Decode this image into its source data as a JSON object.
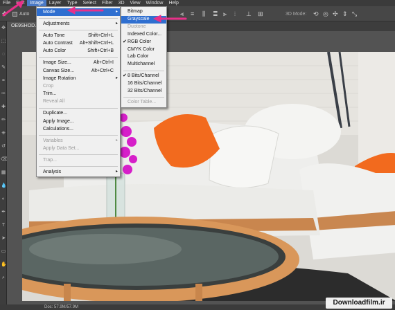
{
  "menubar": {
    "items": [
      "File",
      "Edit",
      "Image",
      "Layer",
      "Type",
      "Select",
      "Filter",
      "3D",
      "View",
      "Window",
      "Help"
    ],
    "active_index": 2
  },
  "options_bar": {
    "auto_label": "Auto",
    "mode_label": "3D Mode:"
  },
  "document": {
    "tab_title": "OE9SHOD.jp"
  },
  "image_menu": {
    "items": [
      {
        "label": "Mode",
        "submenu": true,
        "highlighted": true
      },
      {
        "separator": true
      },
      {
        "label": "Adjustments",
        "submenu": true
      },
      {
        "separator": true
      },
      {
        "label": "Auto Tone",
        "shortcut": "Shift+Ctrl+L"
      },
      {
        "label": "Auto Contrast",
        "shortcut": "Alt+Shift+Ctrl+L"
      },
      {
        "label": "Auto Color",
        "shortcut": "Shift+Ctrl+B"
      },
      {
        "separator": true
      },
      {
        "label": "Image Size...",
        "shortcut": "Alt+Ctrl+I"
      },
      {
        "label": "Canvas Size...",
        "shortcut": "Alt+Ctrl+C"
      },
      {
        "label": "Image Rotation",
        "submenu": true
      },
      {
        "label": "Crop",
        "disabled": true
      },
      {
        "label": "Trim..."
      },
      {
        "label": "Reveal All",
        "disabled": true
      },
      {
        "separator": true
      },
      {
        "label": "Duplicate..."
      },
      {
        "label": "Apply Image..."
      },
      {
        "label": "Calculations..."
      },
      {
        "separator": true
      },
      {
        "label": "Variables",
        "submenu": true,
        "disabled": true
      },
      {
        "label": "Apply Data Set...",
        "disabled": true
      },
      {
        "separator": true
      },
      {
        "label": "Trap...",
        "disabled": true
      },
      {
        "separator": true
      },
      {
        "label": "Analysis",
        "submenu": true
      }
    ]
  },
  "mode_submenu": {
    "items": [
      {
        "label": "Bitmap"
      },
      {
        "label": "Grayscale",
        "highlighted": true
      },
      {
        "label": "Duotone",
        "disabled": true
      },
      {
        "label": "Indexed Color..."
      },
      {
        "label": "RGB Color",
        "checked": true
      },
      {
        "label": "CMYK Color"
      },
      {
        "label": "Lab Color"
      },
      {
        "label": "Multichannel"
      },
      {
        "separator": true
      },
      {
        "label": "8 Bits/Channel",
        "checked": true
      },
      {
        "label": "16 Bits/Channel"
      },
      {
        "label": "32 Bits/Channel"
      },
      {
        "separator": true
      },
      {
        "label": "Color Table...",
        "disabled": true
      }
    ]
  },
  "status": {
    "text": "Doc: 57.9M/57.9M"
  },
  "watermark": "Downloadfilm.ir",
  "colors": {
    "menu_bg": "#f0f0f0",
    "highlight": "#2f6fd0",
    "annotation_arrow": "#e8308a",
    "pillow": "#f26a1e",
    "flowers": "#d61fc9"
  },
  "icons": [
    "move-icon",
    "arrow-annotation-icon",
    "align-icon",
    "distribute-icon",
    "3d-mode-icon",
    "check-icon",
    "submenu-arrow-icon"
  ]
}
